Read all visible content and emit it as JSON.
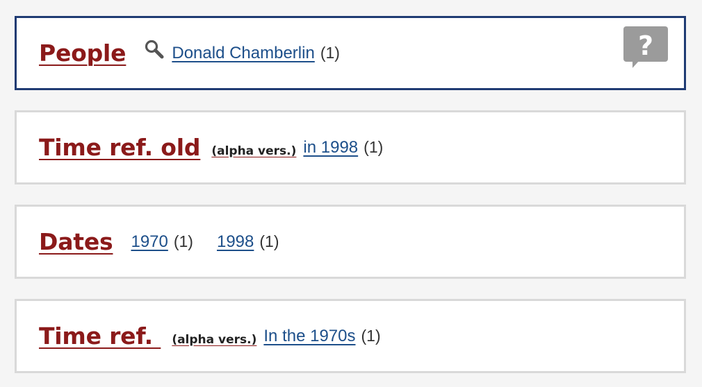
{
  "panels": {
    "people": {
      "title": "People",
      "entries": [
        {
          "label": "Donald Chamberlin",
          "count": "(1)"
        }
      ],
      "help_icon": "help-question-icon",
      "search_icon": "search-icon"
    },
    "timeref_old": {
      "title": "Time ref. old",
      "badge": "(alpha vers.)",
      "entries": [
        {
          "label": "in 1998",
          "count": "(1)"
        }
      ]
    },
    "dates": {
      "title": "Dates",
      "entries": [
        {
          "label": "1970",
          "count": "(1)"
        },
        {
          "label": "1998",
          "count": "(1)"
        }
      ]
    },
    "timeref": {
      "title": "Time ref. ",
      "badge": "(alpha vers.)",
      "entries": [
        {
          "label": "In the 1970s",
          "count": "(1)"
        }
      ]
    }
  },
  "colors": {
    "title": "#8b1a1a",
    "link": "#1d4f8a",
    "active_border": "#1f3b73",
    "inactive_border": "#d9d9d9",
    "background": "#f5f5f5"
  }
}
